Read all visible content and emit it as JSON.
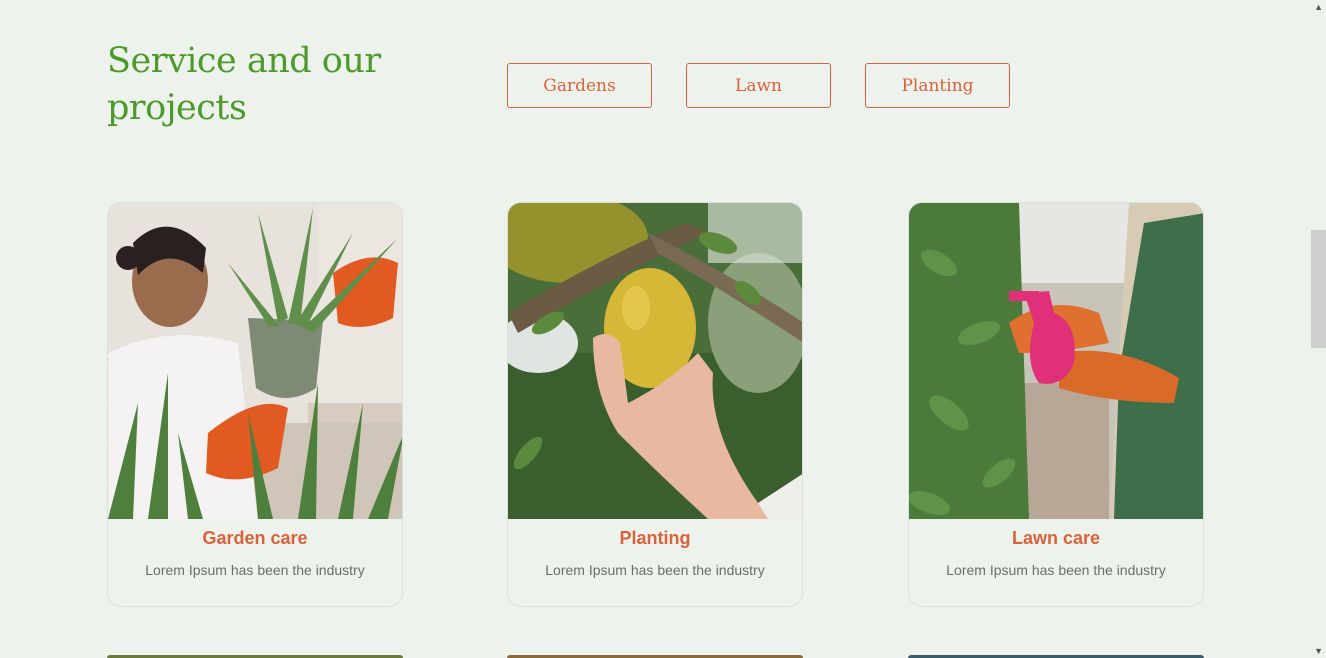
{
  "section": {
    "title": "Service and our projects"
  },
  "filters": [
    {
      "label": "Gardens"
    },
    {
      "label": "Lawn"
    },
    {
      "label": "Planting"
    }
  ],
  "cards": [
    {
      "title": "Garden care",
      "text": "Lorem Ipsum has been the industry",
      "image": "woman-with-aloe-plant-photo"
    },
    {
      "title": "Planting",
      "text": "Lorem Ipsum has been the industry",
      "image": "hand-holding-lemon-photo"
    },
    {
      "title": "Lawn care",
      "text": "Lorem Ipsum has been the industry",
      "image": "gardener-spraying-plants-photo"
    }
  ],
  "colors": {
    "background": "#eef2ed",
    "title_green": "#4c9a2a",
    "accent_orange": "#d9623a",
    "text_gray": "#6b6f6b"
  },
  "scrollbar": {
    "up_icon": "chevron-up-icon",
    "down_icon": "chevron-down-icon"
  }
}
